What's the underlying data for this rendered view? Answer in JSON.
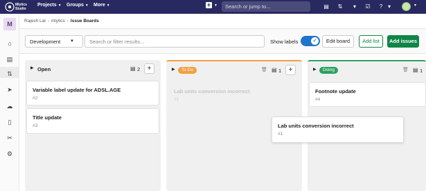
{
  "topbar": {
    "brand_line1": "Mlytics",
    "brand_line2": "Studio",
    "nav": [
      "Projects",
      "Groups",
      "More"
    ],
    "search_placeholder": "Search or jump to..."
  },
  "sidebar": {
    "project_initial": "M"
  },
  "breadcrumb": [
    "Rajesh Lal",
    "mlytics",
    "Issue Boards"
  ],
  "filters": {
    "board_select": "Development",
    "search_placeholder": "Search or filter results...",
    "show_labels": "Show labels",
    "edit_board": "Edit board",
    "add_list": "Add list",
    "add_issues": "Add issues"
  },
  "columns": [
    {
      "title": "Open",
      "count": "2",
      "cards": [
        {
          "title": "Variable label update for ADSL.AGE",
          "number": "#2"
        },
        {
          "title": "Title update",
          "number": "#3"
        }
      ]
    },
    {
      "label": "To Do",
      "label_color": "#f0a040",
      "count": "1",
      "cards": [
        {
          "title": "Lab units conversion incorrect",
          "number": "#1"
        }
      ]
    },
    {
      "label": "Doing",
      "label_color": "#2da160",
      "count": "1",
      "cards": [
        {
          "title": "Footnote update",
          "number": "#4"
        }
      ]
    }
  ],
  "dragged_card": {
    "title": "Lab units conversion incorrect",
    "number": "#1"
  }
}
